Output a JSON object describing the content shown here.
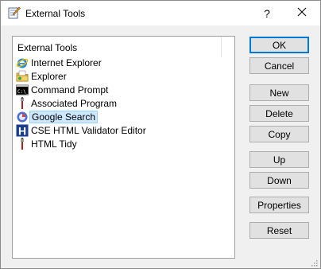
{
  "window": {
    "title": "External Tools",
    "help_label": "?",
    "icon": "notepad-pencil-icon",
    "close_icon": "close-icon"
  },
  "list": {
    "header": "External Tools",
    "items": [
      {
        "label": "Internet Explorer",
        "icon": "internet-explorer-icon",
        "selected": false
      },
      {
        "label": "Explorer",
        "icon": "folder-icon",
        "selected": false
      },
      {
        "label": "Command Prompt",
        "icon": "command-prompt-icon",
        "selected": false
      },
      {
        "label": "Associated Program",
        "icon": "tool-icon",
        "selected": false
      },
      {
        "label": "Google Search",
        "icon": "google-icon",
        "selected": true
      },
      {
        "label": "CSE HTML Validator Editor",
        "icon": "cse-h-icon",
        "selected": false
      },
      {
        "label": "HTML Tidy",
        "icon": "tool-icon",
        "selected": false
      }
    ]
  },
  "buttons": {
    "ok": "OK",
    "cancel": "Cancel",
    "new": "New",
    "delete": "Delete",
    "copy": "Copy",
    "up": "Up",
    "down": "Down",
    "properties": "Properties",
    "reset": "Reset"
  },
  "colors": {
    "selection_bg": "#cce8ff",
    "selection_border": "#99d1ff",
    "default_button_border": "#0078d7"
  }
}
